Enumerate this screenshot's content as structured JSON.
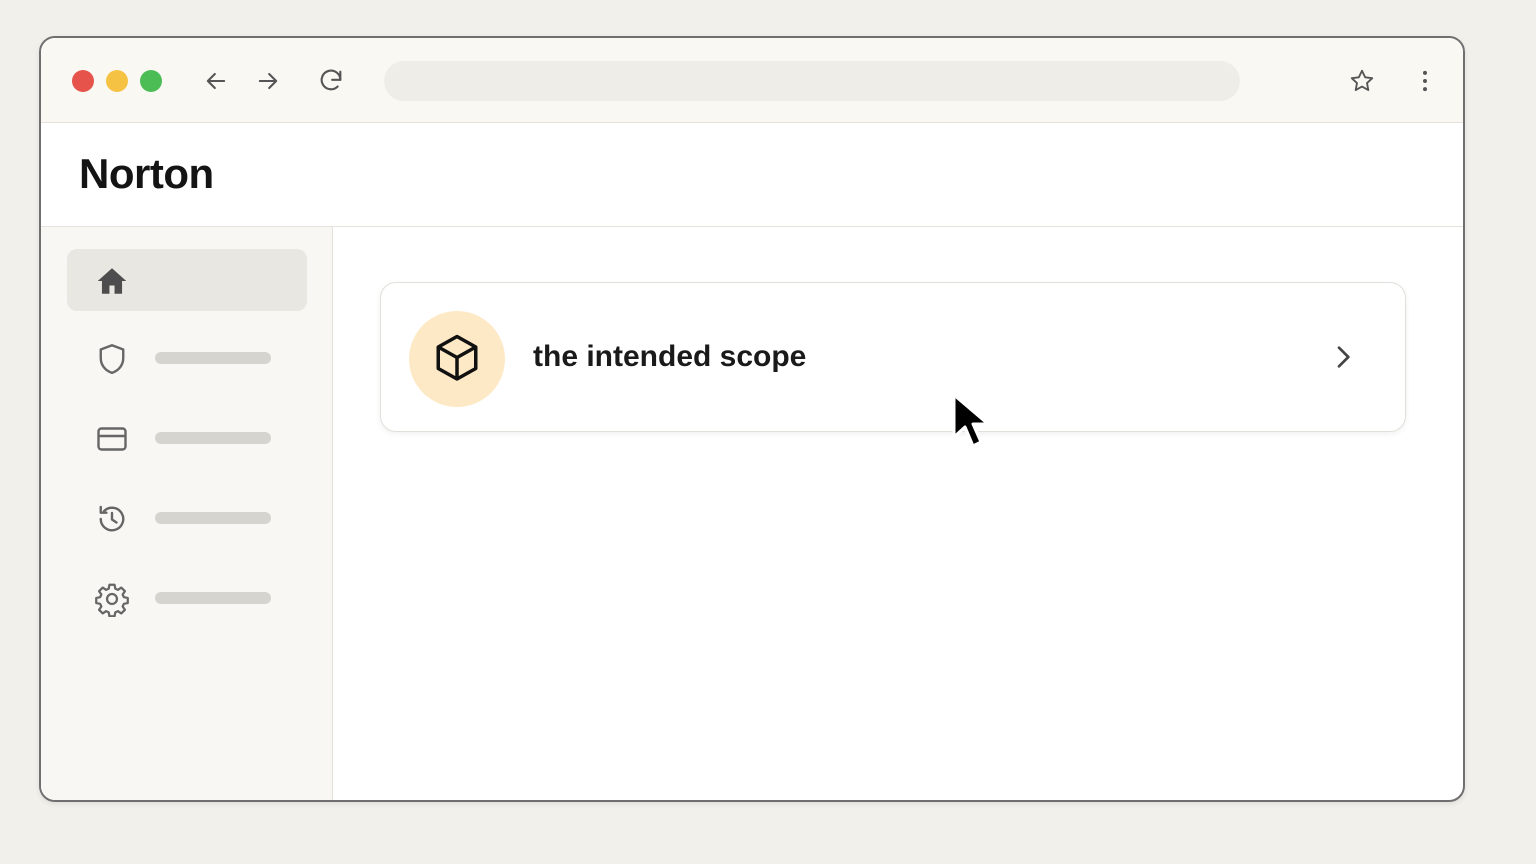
{
  "window": {
    "traffic_lights": {
      "close_color": "#e5534b",
      "minimize_color": "#f5c244",
      "maximize_color": "#4cbd55"
    },
    "toolbar_icons": {
      "back": "arrow-left-icon",
      "forward": "arrow-right-icon",
      "reload": "reload-icon",
      "bookmark": "star-icon",
      "menu": "more-vertical-icon"
    },
    "address_bar": {
      "value": ""
    }
  },
  "header": {
    "title": "Norton"
  },
  "sidebar": {
    "items": [
      {
        "icon": "home-icon",
        "label": "",
        "active": true
      },
      {
        "icon": "shield-icon",
        "label": "",
        "active": false
      },
      {
        "icon": "credit-card-icon",
        "label": "",
        "active": false
      },
      {
        "icon": "history-icon",
        "label": "",
        "active": false
      },
      {
        "icon": "gear-icon",
        "label": "",
        "active": false
      }
    ]
  },
  "main": {
    "card": {
      "icon": "box-icon",
      "label": "the intended scope",
      "icon_bg_color": "#fde9c5",
      "chevron": "chevron-right-icon"
    }
  },
  "colors": {
    "page_bg": "#f2f0eb",
    "sidebar_bg": "#f8f7f3",
    "active_item_bg": "#e9e7e1",
    "icon_gray": "#5f5f5f"
  }
}
